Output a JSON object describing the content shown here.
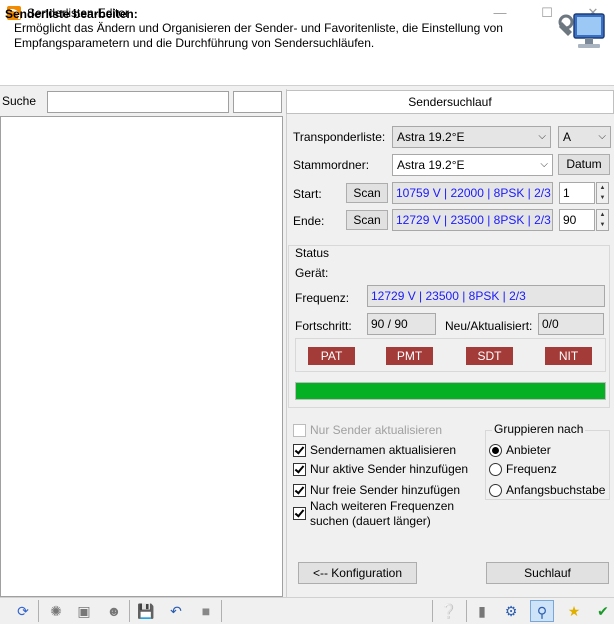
{
  "window": {
    "title": "Senderlisten-Editor"
  },
  "header": {
    "title": "Senderliste bearbeiten:",
    "description": "Ermöglicht das Ändern und Organisieren der Sender- und Favoritenliste, die Einstellung von Empfangsparametern und die Durchführung von Sendersuchläufen."
  },
  "left": {
    "search_label": "Suche",
    "search_value": "",
    "search_value2": ""
  },
  "scan": {
    "tab_label": "Sendersuchlauf",
    "transponder_label": "Transponderliste:",
    "transponder_value": "Astra 19.2°E",
    "transponder_ab": "A",
    "stammordner_label": "Stammordner:",
    "stammordner_value": "Astra 19.2°E",
    "datum_button": "Datum",
    "start_label": "Start:",
    "start_scan_button": "Scan",
    "start_value": "10759 V | 22000 | 8PSK | 2/3",
    "start_index": "1",
    "ende_label": "Ende:",
    "ende_scan_button": "Scan",
    "ende_value": "12729 V | 23500 | 8PSK | 2/3",
    "ende_index": "90"
  },
  "status": {
    "title": "Status",
    "geraet_label": "Gerät:",
    "geraet_value": "",
    "frequenz_label": "Frequenz:",
    "frequenz_value": "12729 V | 23500 | 8PSK | 2/3",
    "fortschritt_label": "Fortschritt:",
    "fortschritt_value": "90 / 90",
    "neu_label": "Neu/Aktualisiert:",
    "neu_value": "0/0",
    "tables": [
      "PAT",
      "PMT",
      "SDT",
      "NIT"
    ],
    "progress": 1.0,
    "badge_color": "#a33b38",
    "progress_color": "#06b025"
  },
  "options": {
    "nur_sender_aktualisieren": "Nur Sender aktualisieren",
    "sendernamen": "Sendernamen aktualisieren",
    "nur_aktive": "Nur aktive Sender hinzufügen",
    "nur_freie": "Nur freie Sender hinzufügen",
    "weitere_1": "Nach weiteren Frequenzen",
    "weitere_2": "suchen (dauert länger)"
  },
  "group": {
    "title": "Gruppieren nach",
    "anbieter": "Anbieter",
    "frequenz": "Frequenz",
    "anfangsbuchstabe": "Anfangsbuchstabe"
  },
  "buttons": {
    "konfiguration": "<-- Konfiguration",
    "suchlauf": "Suchlauf"
  }
}
